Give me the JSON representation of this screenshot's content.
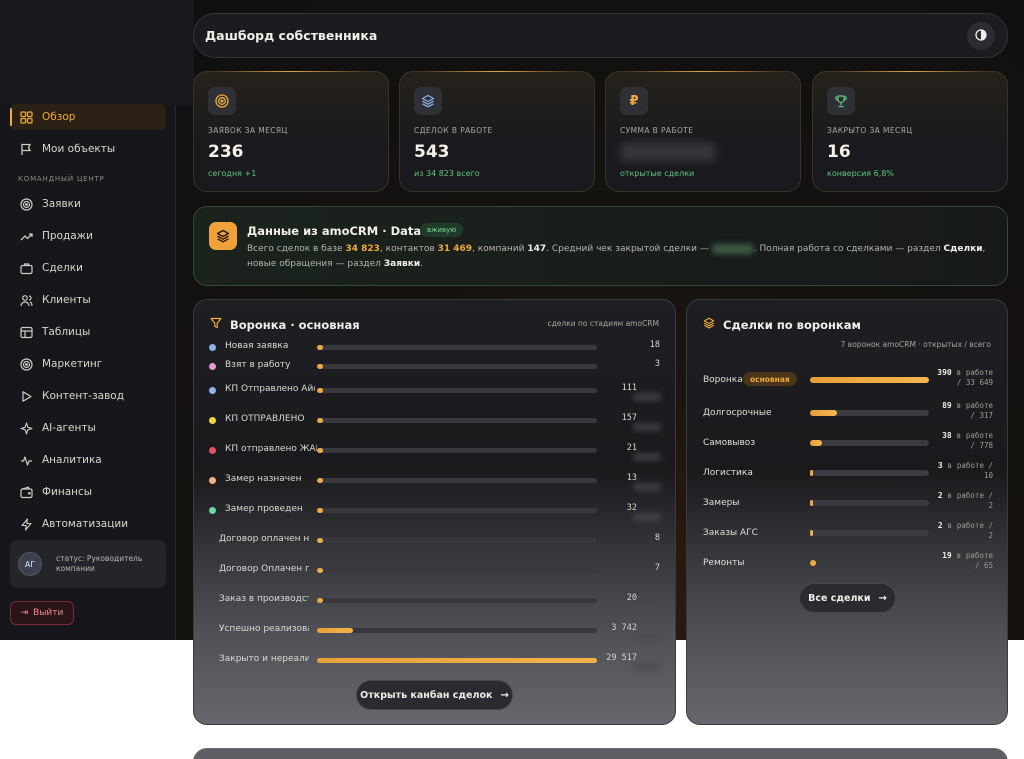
{
  "header": {
    "title": "Дашборд собственника",
    "theme_icon": "half-moon-icon"
  },
  "sidebar": {
    "section_label": "КОМАНДНЫЙ ЦЕНТР",
    "items": [
      {
        "label": "Обзор",
        "icon": "grid-icon",
        "active": true
      },
      {
        "label": "Мои объекты",
        "icon": "flag-icon"
      },
      {
        "label": "Заявки",
        "icon": "target-icon"
      },
      {
        "label": "Продажи",
        "icon": "trend-icon"
      },
      {
        "label": "Сделки",
        "icon": "briefcase-icon"
      },
      {
        "label": "Клиенты",
        "icon": "users-icon"
      },
      {
        "label": "Таблицы",
        "icon": "table-icon"
      },
      {
        "label": "Маркетинг",
        "icon": "target-icon"
      },
      {
        "label": "Контент-завод",
        "icon": "play-icon"
      },
      {
        "label": "AI-агенты",
        "icon": "sparkle-icon"
      },
      {
        "label": "Аналитика",
        "icon": "pulse-icon"
      },
      {
        "label": "Финансы",
        "icon": "wallet-icon"
      },
      {
        "label": "Автоматизации",
        "icon": "bolt-icon"
      }
    ],
    "user": {
      "initials": "АГ",
      "status": "статус: Руководитель компании"
    },
    "logout_label": "Выйти"
  },
  "stats": [
    {
      "label": "ЗАЯВОК ЗА МЕСЯЦ",
      "value": "236",
      "sub": "сегодня +1",
      "icon": "target-icon",
      "icon_color": "#f0a93b"
    },
    {
      "label": "СДЕЛОК В РАБОТЕ",
      "value": "543",
      "sub": "из 34 823 всего",
      "icon": "layers-icon",
      "icon_color": "#8fb4e8"
    },
    {
      "label": "СУММА В РАБОТЕ",
      "value": "",
      "sub": "открытые сделки",
      "icon": "ruble-icon",
      "icon_color": "#f0a93b"
    },
    {
      "label": "ЗАКРЫТО ЗА МЕСЯЦ",
      "value": "16",
      "sub": "конверсия 6,8%",
      "icon": "trophy-icon",
      "icon_color": "#5fc37e"
    }
  ],
  "datahub": {
    "title": "Данные из amoCRM · Data Hub",
    "badge": "вживую",
    "t1": "Всего сделок в базе",
    "deals": "34 823",
    "t2": ", контактов",
    "contacts": "31 469",
    "t3": ", компаний",
    "companies": "147",
    "t4": ". Средний чек закрытой сделки —",
    "t5": ". Полная работа со сделками — раздел",
    "link1": "Сделки",
    "t6": ", новые обращения — раздел",
    "link2": "Заявки",
    "t7": "."
  },
  "funnel": {
    "title": "Воронка · основная",
    "subtitle": "сделки по стадиям amoCRM",
    "button": "Открыть канбан сделок",
    "stages": [
      {
        "label": "Новая заявка",
        "value": "18",
        "fraction": 0.0,
        "dot": "#8fb4e8"
      },
      {
        "label": "Взят в работу",
        "value": "3",
        "fraction": 0.0,
        "dot": "#e59ad1"
      },
      {
        "label": "КП Отправлено Айс",
        "value": "111",
        "fraction": 0.0,
        "dot": "#8fb4e8"
      },
      {
        "label": "КП ОТПРАВЛЕНО",
        "value": "157",
        "fraction": 0.0,
        "dot": "#f2d33c"
      },
      {
        "label": "КП отправлено ЖАРА",
        "value": "21",
        "fraction": 0.0,
        "dot": "#e8506a"
      },
      {
        "label": "Замер назначен",
        "value": "13",
        "fraction": 0.0,
        "dot": "#f0b48a"
      },
      {
        "label": "Замер проведен",
        "value": "32",
        "fraction": 0.0,
        "dot": "#6fd7a0"
      },
      {
        "label": "Договор оплачен не п",
        "value": "8",
        "fraction": 0.0,
        "dot": ""
      },
      {
        "label": "Договор Оплачен под",
        "value": "7",
        "fraction": 0.0,
        "dot": ""
      },
      {
        "label": "Заказ в производстве",
        "value": "20",
        "fraction": 0.0,
        "dot": ""
      },
      {
        "label": "Успешно реализовано",
        "value": "3 742",
        "fraction": 0.127,
        "dot": ""
      },
      {
        "label": "Закрыто и нереализо",
        "value": "29 517",
        "fraction": 1.0,
        "dot": ""
      }
    ]
  },
  "pipelines": {
    "title": "Сделки по воронкам",
    "subtitle": "7 воронок amoCRM · открытых / всего",
    "badge": "основная",
    "button": "Все сделки",
    "unit1": "в",
    "unit2": "работе",
    "rows": [
      {
        "label": "Воронка",
        "open": "390",
        "total": "33 649",
        "fraction": 1.0
      },
      {
        "label": "Долгосрочные",
        "open": "89",
        "total": "317",
        "fraction": 0.23
      },
      {
        "label": "Самовывоз",
        "open": "38",
        "total": "778",
        "fraction": 0.1
      },
      {
        "label": "Логистика",
        "open": "3",
        "total": "10",
        "fraction": 0.0
      },
      {
        "label": "Замеры",
        "open": "2",
        "total": "2",
        "fraction": 0.0
      },
      {
        "label": "Заказы АГС",
        "open": "2",
        "total": "2",
        "fraction": 0.0
      },
      {
        "label": "Ремонты",
        "open": "19",
        "total": "65",
        "fraction": 0.05
      }
    ]
  }
}
